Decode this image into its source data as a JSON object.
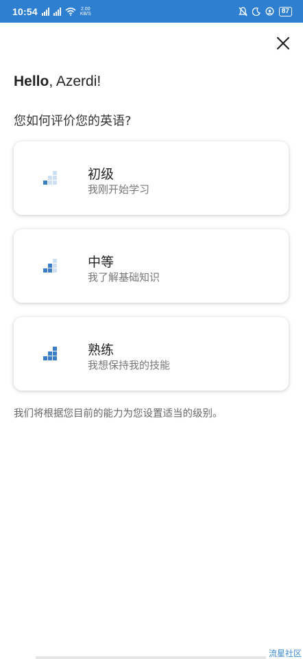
{
  "status_bar": {
    "time": "10:54",
    "net_speed_value": "2.00",
    "net_speed_unit": "KB/S",
    "battery": "87",
    "background": "#2f7fd0"
  },
  "close_icon": "close-icon",
  "greeting": {
    "bold": "Hello",
    "rest": ", Azerdi!"
  },
  "question": "您如何评价您的英语?",
  "levels": [
    {
      "title": "初级",
      "subtitle": "我刚开始学习",
      "filled_bars": 1,
      "icon": "level-bars-icon"
    },
    {
      "title": "中等",
      "subtitle": "我了解基础知识",
      "filled_bars": 2,
      "icon": "level-bars-icon"
    },
    {
      "title": "熟练",
      "subtitle": "我想保持我的技能",
      "filled_bars": 3,
      "icon": "level-bars-icon"
    }
  ],
  "footer_note": "我们将根据您目前的能力为您设置适当的级别。",
  "watermark": "流星社区",
  "colors": {
    "accent": "#3a7ec6",
    "accent_light": "#cfe0f2"
  }
}
